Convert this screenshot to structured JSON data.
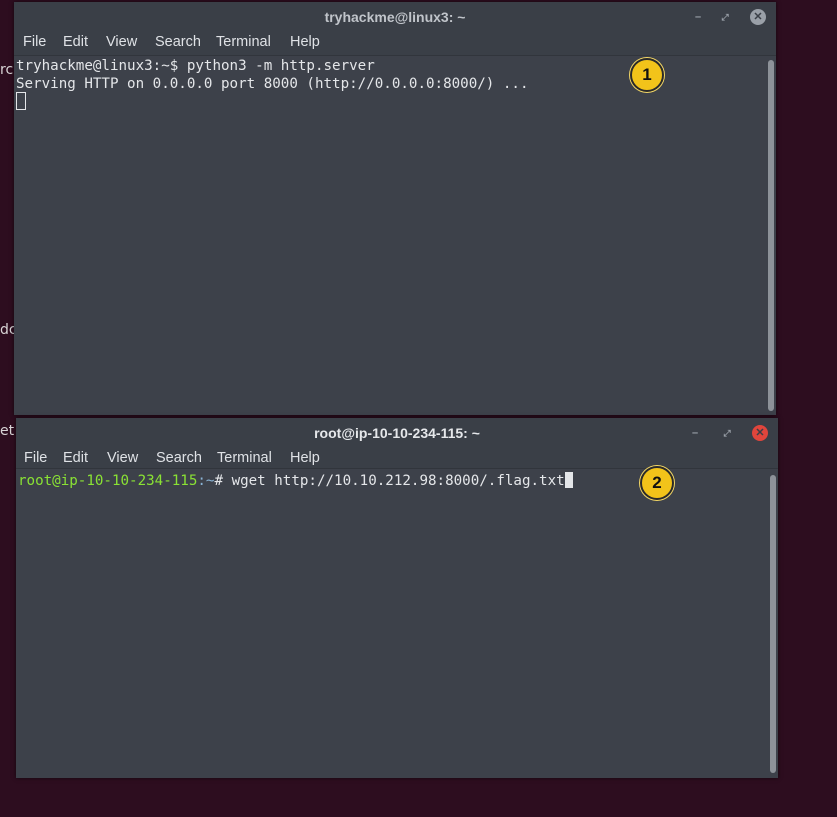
{
  "desktop_fragments": [
    "rc",
    "dc",
    "et"
  ],
  "terminal1": {
    "title": "tryhackme@linux3: ~",
    "menu": [
      "File",
      "Edit",
      "View",
      "Search",
      "Terminal",
      "Help"
    ],
    "prompt": "tryhackme@linux3:~$ ",
    "command": "python3 -m http.server",
    "output": "Serving HTTP on 0.0.0.0 port 8000 (http://0.0.0.0:8000/) ...",
    "badge": "1"
  },
  "terminal2": {
    "title": "root@ip-10-10-234-115: ~",
    "menu": [
      "File",
      "Edit",
      "View",
      "Search",
      "Terminal",
      "Help"
    ],
    "prompt_user": "root@ip-10-10-234-115",
    "prompt_path": ":~",
    "prompt_symbol": "# ",
    "command": "wget http://10.10.212.98:8000/.flag.txt",
    "badge": "2"
  },
  "colors": {
    "prompt_green": "#8ae234",
    "badge_yellow": "#f2c31a",
    "close_red": "#e0453c"
  },
  "icons": [
    "minimize-icon",
    "maximize-icon",
    "close-icon"
  ]
}
